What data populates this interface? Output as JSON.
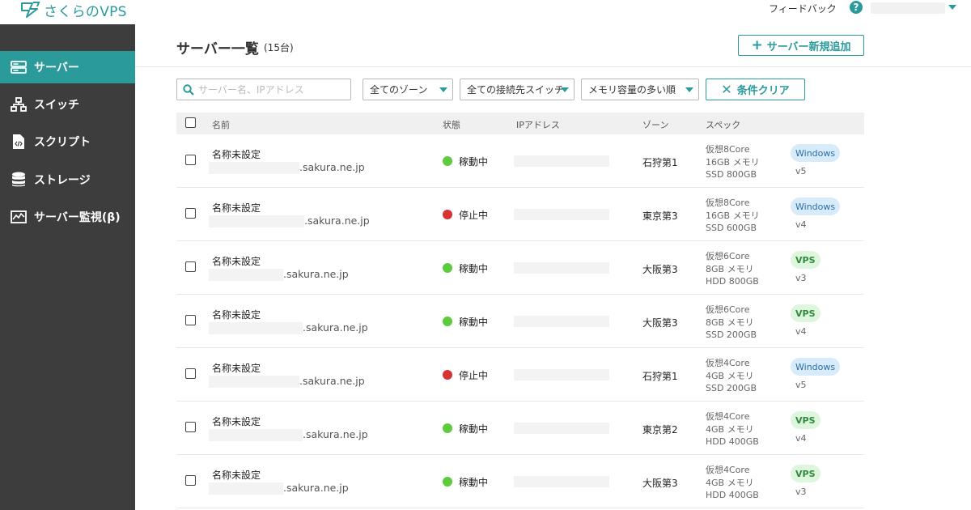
{
  "brand": {
    "name": "さくらのVPS",
    "color": "#2a9a9a"
  },
  "header": {
    "feedback_label": "フィードバック",
    "help_icon": "question-circle-icon"
  },
  "sidebar": {
    "items": [
      {
        "label": "サーバー",
        "icon": "server-icon",
        "active": true
      },
      {
        "label": "スイッチ",
        "icon": "network-icon",
        "active": false
      },
      {
        "label": "スクリプト",
        "icon": "script-file-icon",
        "active": false
      },
      {
        "label": "ストレージ",
        "icon": "database-icon",
        "active": false
      },
      {
        "label": "サーバー監視(β)",
        "icon": "monitor-chart-icon",
        "active": false
      }
    ]
  },
  "main": {
    "title": "サーバー一覧",
    "count": "(15台)",
    "add_button": "サーバー新規追加",
    "search_placeholder": "サーバー名、IPアドレス",
    "filters": {
      "zone": "全てのゾーン",
      "switch": "全ての接続先スイッチ",
      "sort": "メモリ容量の多い順"
    },
    "clear_button": "条件クリア",
    "columns": {
      "name": "名前",
      "status": "状態",
      "ip": "IPアドレス",
      "zone": "ゾーン",
      "spec": "スペック"
    },
    "status_colors": {
      "running": "#5ccb3c",
      "stopped": "#d63232"
    },
    "rows": [
      {
        "name": "名称未設定",
        "host": ".sakura.ne.jp",
        "status": "稼動中",
        "state": "running",
        "zone": "石狩第1",
        "cpu": "仮想8Core",
        "mem": "16GB メモリ",
        "disk": "SSD 800GB",
        "plan": "Windows",
        "version": "v5"
      },
      {
        "name": "名称未設定",
        "host": ".sakura.ne.jp",
        "status": "停止中",
        "state": "stopped",
        "zone": "東京第3",
        "cpu": "仮想8Core",
        "mem": "16GB メモリ",
        "disk": "SSD 600GB",
        "plan": "Windows",
        "version": "v4"
      },
      {
        "name": "名称未設定",
        "host": ".sakura.ne.jp",
        "status": "稼動中",
        "state": "running",
        "zone": "大阪第3",
        "cpu": "仮想6Core",
        "mem": "8GB メモリ",
        "disk": "HDD 800GB",
        "plan": "VPS",
        "version": "v3"
      },
      {
        "name": "名称未設定",
        "host": ".sakura.ne.jp",
        "status": "稼動中",
        "state": "running",
        "zone": "大阪第3",
        "cpu": "仮想6Core",
        "mem": "8GB メモリ",
        "disk": "SSD 200GB",
        "plan": "VPS",
        "version": "v4"
      },
      {
        "name": "名称未設定",
        "host": ".sakura.ne.jp",
        "status": "停止中",
        "state": "stopped",
        "zone": "石狩第1",
        "cpu": "仮想4Core",
        "mem": "4GB メモリ",
        "disk": "SSD 200GB",
        "plan": "Windows",
        "version": "v5"
      },
      {
        "name": "名称未設定",
        "host": ".sakura.ne.jp",
        "status": "稼動中",
        "state": "running",
        "zone": "東京第2",
        "cpu": "仮想4Core",
        "mem": "4GB メモリ",
        "disk": "HDD 400GB",
        "plan": "VPS",
        "version": "v4"
      },
      {
        "name": "名称未設定",
        "host": ".sakura.ne.jp",
        "status": "稼動中",
        "state": "running",
        "zone": "大阪第3",
        "cpu": "仮想4Core",
        "mem": "4GB メモリ",
        "disk": "HDD 400GB",
        "plan": "VPS",
        "version": "v3"
      }
    ]
  }
}
